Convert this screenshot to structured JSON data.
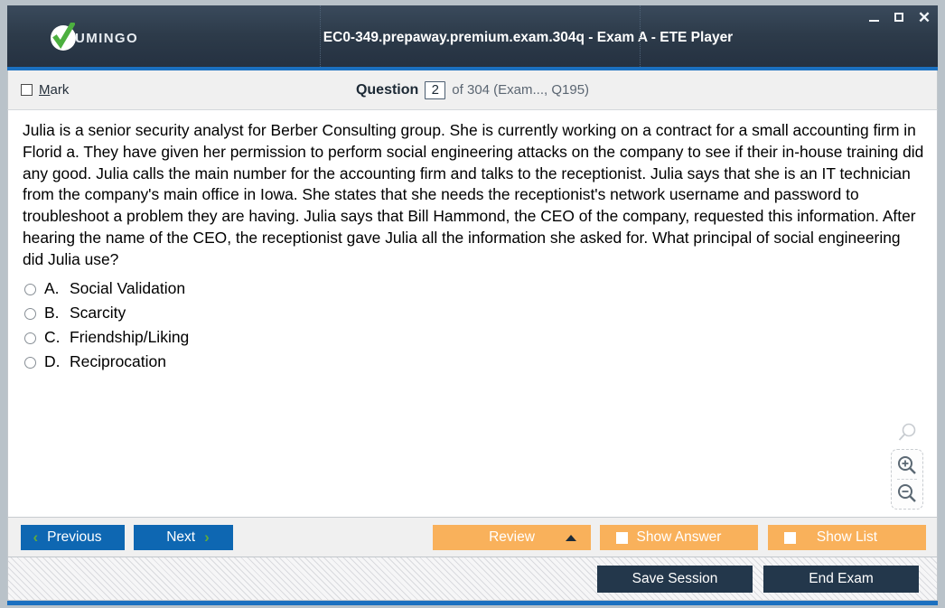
{
  "window": {
    "title": "EC0-349.prepaway.premium.exam.304q - Exam A - ETE Player",
    "brand": "UMINGO",
    "minimize_label": "Minimize",
    "maximize_label": "Maximize",
    "close_label": "✕",
    "accent_blue": "#1b70c0",
    "titlebar_dark": "#2d3b4a",
    "brand_green": "#4caf3f"
  },
  "header": {
    "mark_label_prefix": "",
    "mark_label": "Mark",
    "mark_accel": "M",
    "mark_rest": "ark",
    "mark_checked": false,
    "question_word": "Question",
    "question_number": "2",
    "question_rest": "of 304 (Exam..., Q195)"
  },
  "question": {
    "text": "Julia is a senior security analyst for Berber Consulting group. She is currently working on a contract for a small accounting firm in Florid a. They have given her permission to perform social engineering attacks on the company to see if their in-house training did any good. Julia calls the main number for the accounting firm and talks to the receptionist. Julia says that she is an IT technician from the company's main office in Iowa. She states that she needs the receptionist's network username and password to troubleshoot a problem they are having. Julia says that Bill Hammond, the CEO of the company, requested this information. After hearing the name of the CEO, the receptionist gave Julia all the information she asked for. What principal of social engineering did Julia use?",
    "options": [
      {
        "letter": "A.",
        "text": "Social Validation",
        "selected": false
      },
      {
        "letter": "B.",
        "text": "Scarcity",
        "selected": false
      },
      {
        "letter": "C.",
        "text": "Friendship/Liking",
        "selected": false
      },
      {
        "letter": "D.",
        "text": "Reciprocation",
        "selected": false
      }
    ]
  },
  "zoom_widget": {
    "search_icon": "magnifier-icon",
    "zoom_in_icon": "magnifier-plus-icon",
    "zoom_out_icon": "magnifier-minus-icon"
  },
  "toolbar": {
    "previous_label": "Previous",
    "previous_chevron": "‹",
    "next_label": "Next",
    "next_chevron": "›",
    "review_label": "Review",
    "show_answer_label": "Show Answer",
    "show_list_label": "Show List",
    "blue": "#0e67b2",
    "orange": "#f9b15b",
    "chevron_green": "#5faa3c"
  },
  "status": {
    "save_session_label": "Save Session",
    "end_exam_label": "End Exam",
    "dark": "#23374b"
  }
}
